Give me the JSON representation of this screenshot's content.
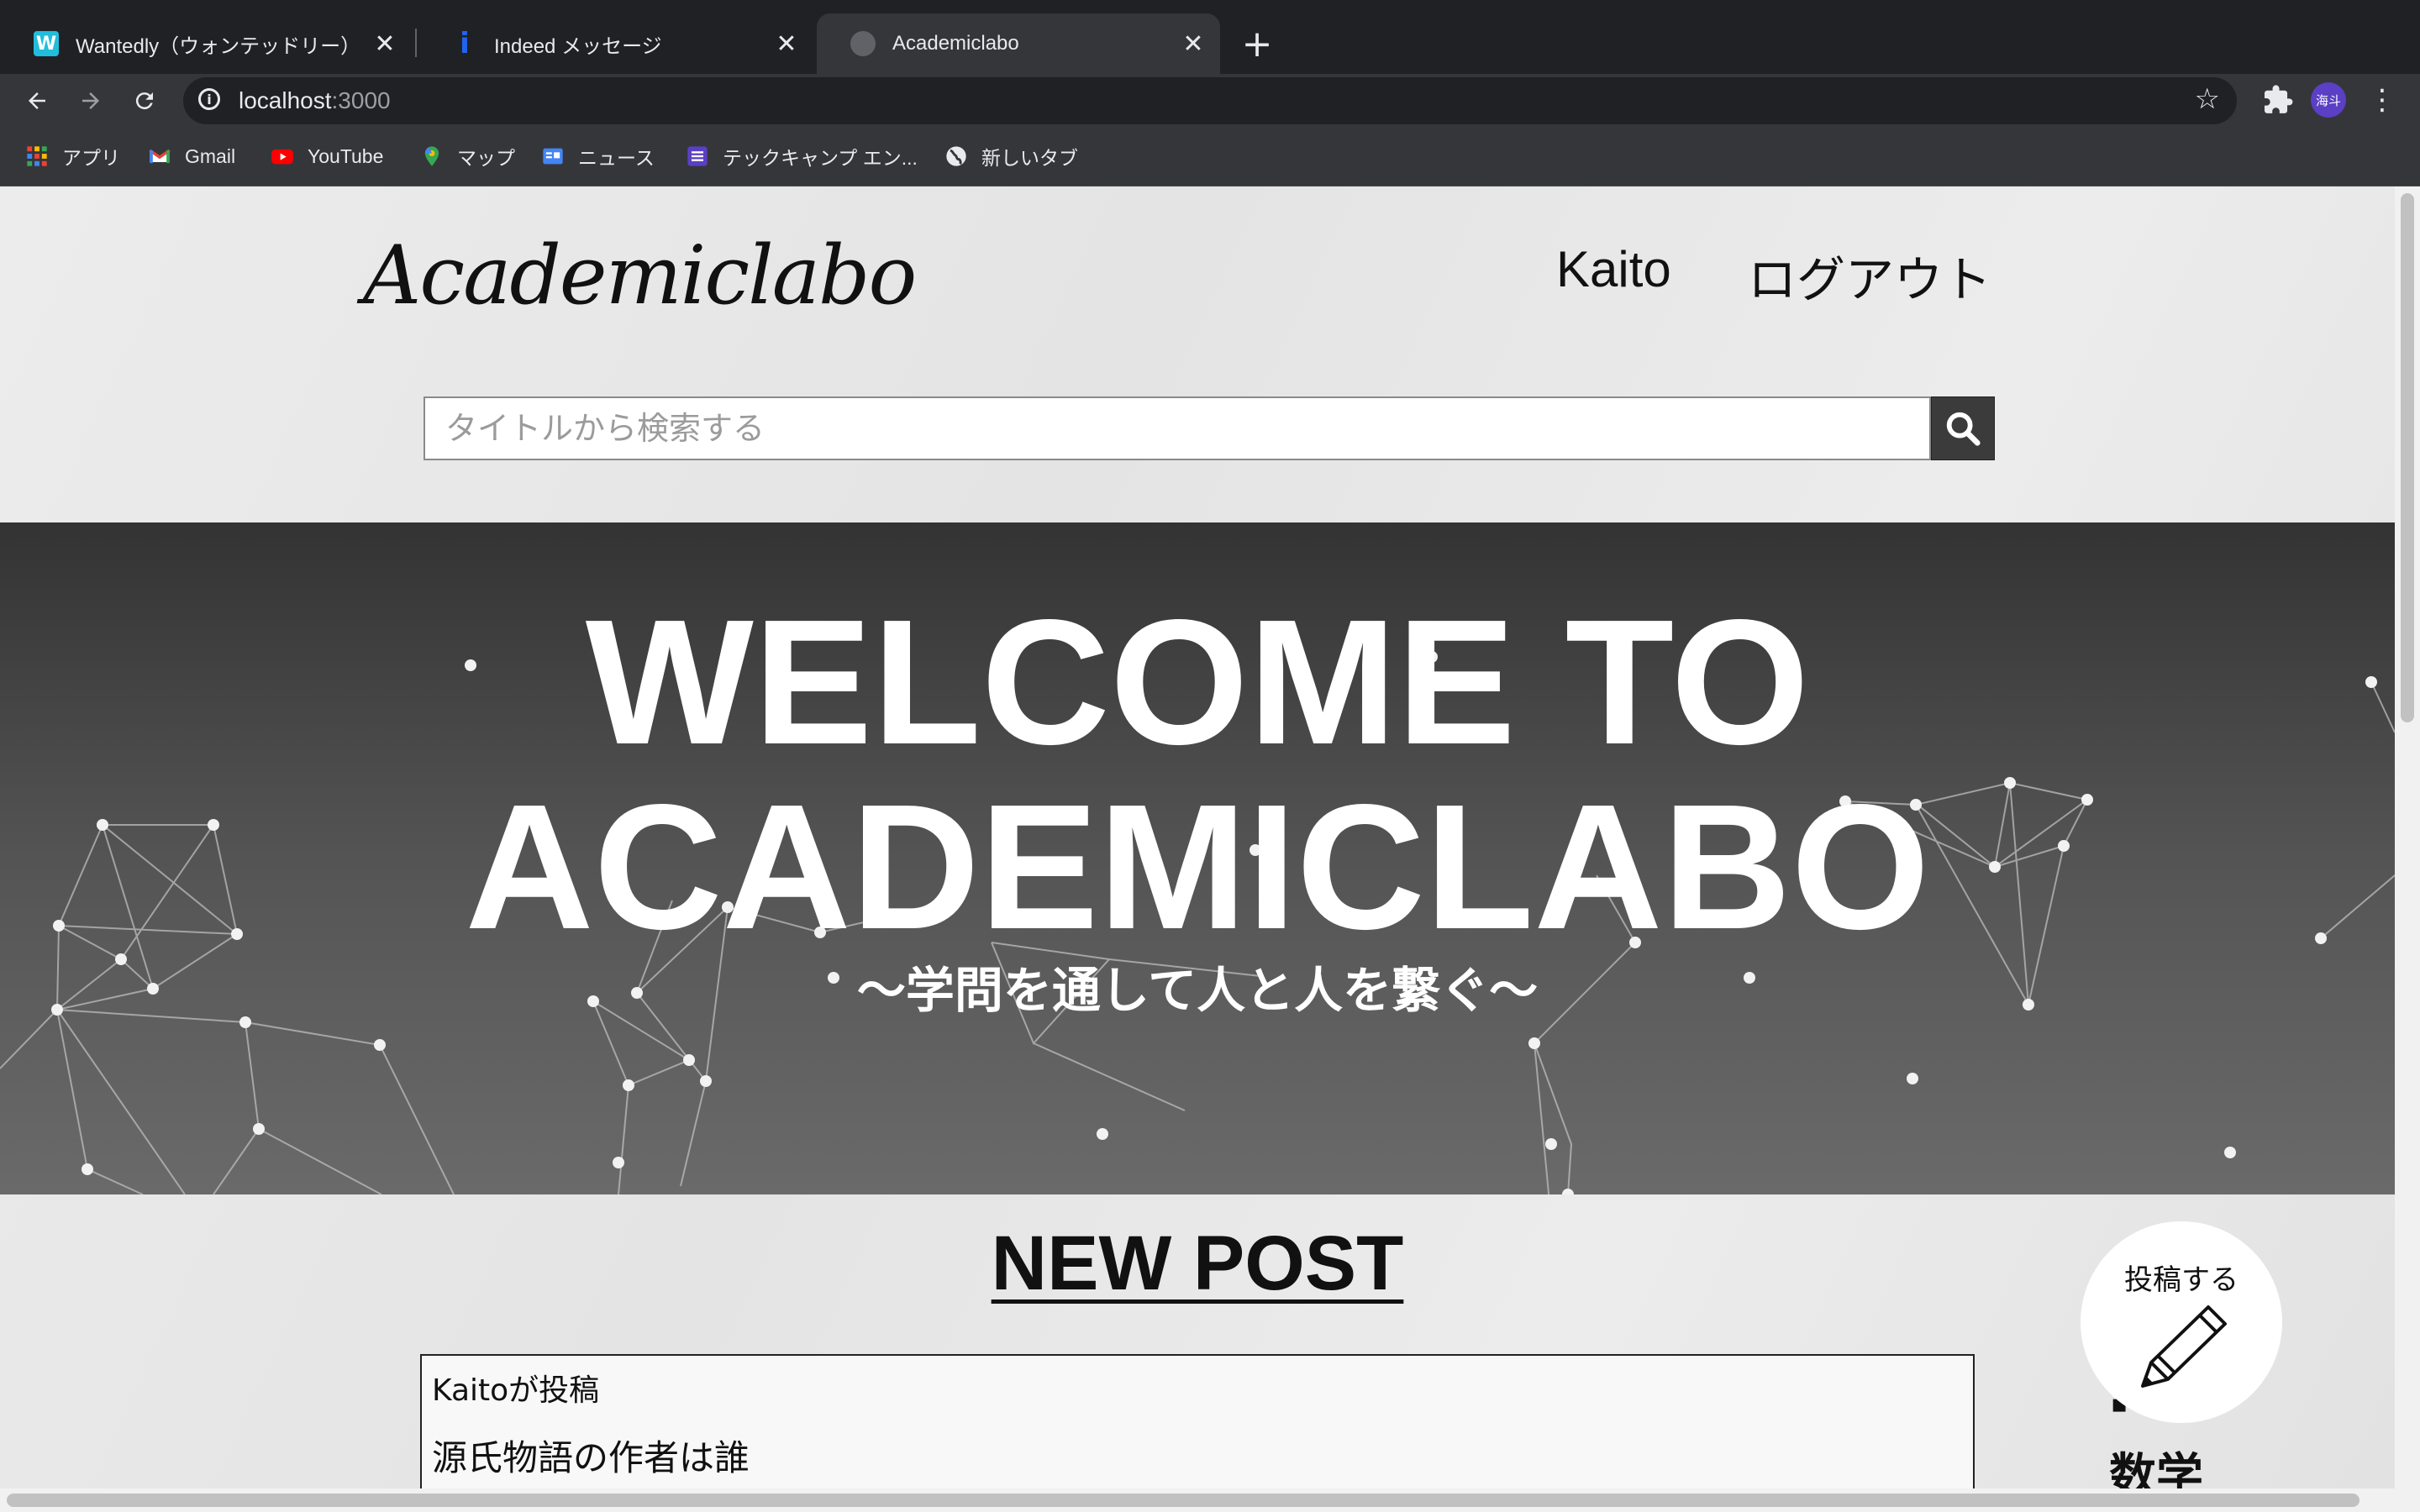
{
  "browser": {
    "tabs": [
      {
        "title": "Wantedly（ウォンテッドリー）は",
        "icon": "wantedly-icon",
        "active": false
      },
      {
        "title": "Indeed メッセージ",
        "icon": "indeed-icon",
        "active": false
      },
      {
        "title": "Academiclabo",
        "icon": "globe-icon",
        "active": true
      }
    ],
    "new_tab": "+",
    "url_host": "localhost",
    "url_port": ":3000",
    "profile_initials": "海斗",
    "bookmarks": [
      {
        "label": "アプリ",
        "icon": "apps-grid-icon"
      },
      {
        "label": "Gmail",
        "icon": "gmail-icon"
      },
      {
        "label": "YouTube",
        "icon": "youtube-icon"
      },
      {
        "label": "マップ",
        "icon": "maps-icon"
      },
      {
        "label": "ニュース",
        "icon": "news-icon"
      },
      {
        "label": "テックキャンプ エン...",
        "icon": "techcamp-icon"
      },
      {
        "label": "新しいタブ",
        "icon": "globe-icon"
      }
    ]
  },
  "site": {
    "logo": "Academiclabo",
    "nav_user": "Kaito",
    "nav_logout": "ログアウト",
    "search_placeholder": "タイトルから検索する",
    "hero_line1": "WELCOME TO",
    "hero_line2": "ACADEMICLABO",
    "hero_subtitle": "〜学問を通して人と人を繋ぐ〜",
    "section_title": "NEW POST",
    "post": {
      "author_line": "Kaitoが投稿",
      "title": "源氏物語の作者は誰"
    },
    "post_button_label": "投稿する",
    "category_label": "数学"
  },
  "colors": {
    "chrome_dark": "#202124",
    "chrome_toolbar": "#35363a",
    "hero_top": "#333333",
    "hero_bottom": "#6a6a6a",
    "page_bg": "#e9e9e9"
  }
}
